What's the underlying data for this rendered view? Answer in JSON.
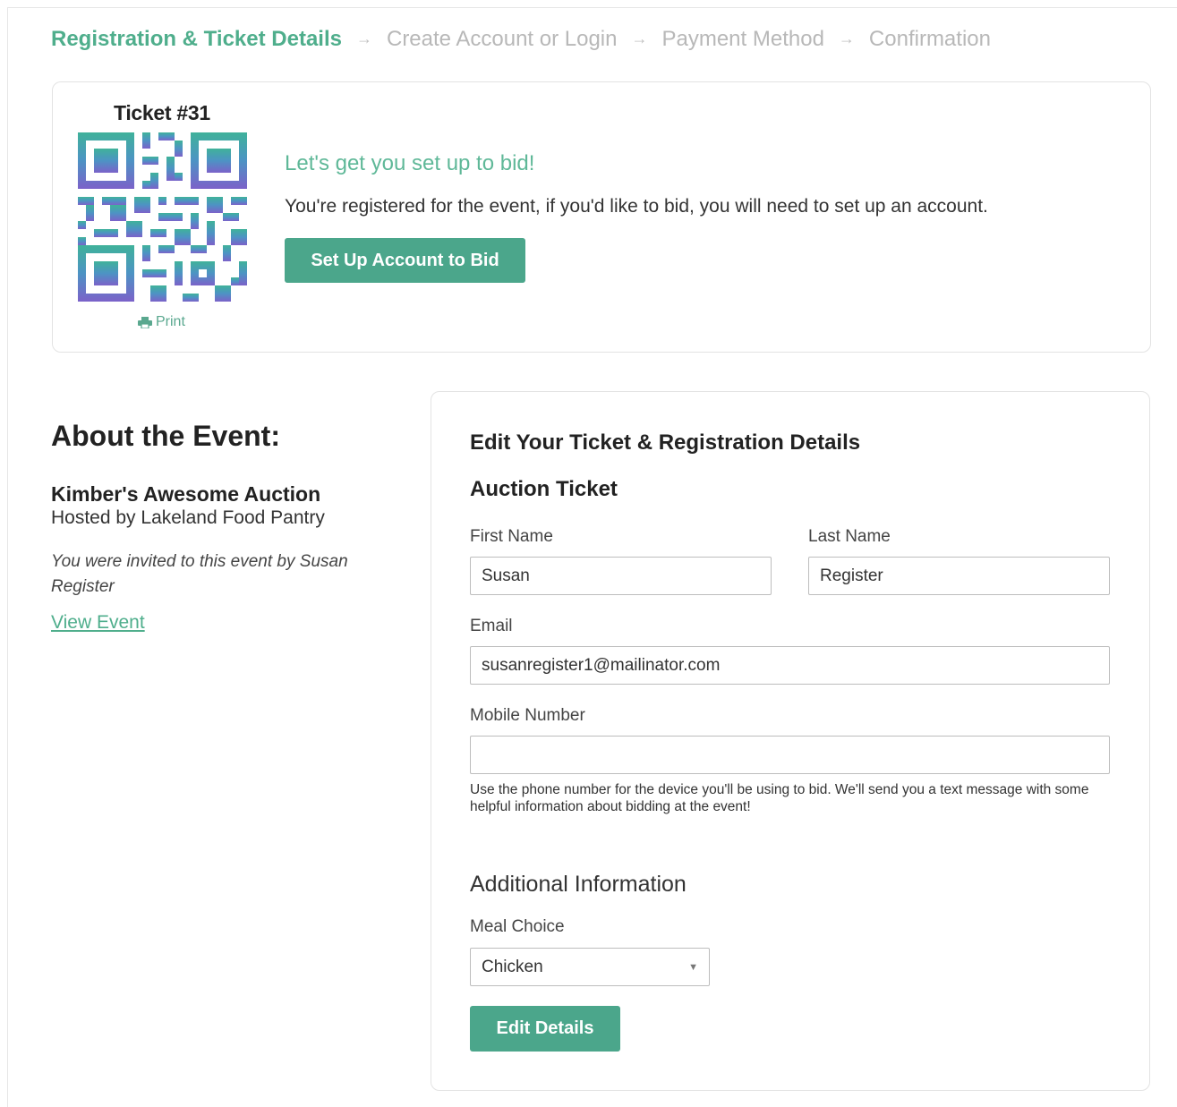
{
  "steps": [
    {
      "label": "Registration & Ticket Details",
      "active": true
    },
    {
      "label": "Create Account or Login",
      "active": false
    },
    {
      "label": "Payment Method",
      "active": false
    },
    {
      "label": "Confirmation",
      "active": false
    }
  ],
  "ticket": {
    "title": "Ticket #31",
    "qr_icon": "qr-code",
    "print_label": "Print",
    "heading": "Let's get you set up to bid!",
    "message": "You're registered for the event, if you'd like to bid, you will need to set up an account.",
    "button_label": "Set Up Account to Bid"
  },
  "about": {
    "title": "About the Event:",
    "event_name": "Kimber's Awesome Auction",
    "hosted_by": "Hosted by Lakeland Food Pantry",
    "invited_text": "You were invited to this event by Susan Register",
    "view_event_label": "View Event"
  },
  "form": {
    "title": "Edit Your Ticket & Registration Details",
    "ticket_type": "Auction Ticket",
    "first_name": {
      "label": "First Name",
      "value": "Susan"
    },
    "last_name": {
      "label": "Last Name",
      "value": "Register"
    },
    "email": {
      "label": "Email",
      "value": "susanregister1@mailinator.com"
    },
    "mobile": {
      "label": "Mobile Number",
      "value": "",
      "help": "Use the phone number for the device you'll be using to bid. We'll send you a text message with some helpful information about bidding at the event!"
    },
    "additional_title": "Additional Information",
    "meal": {
      "label": "Meal Choice",
      "value": "Chicken"
    },
    "submit_label": "Edit Details"
  },
  "colors": {
    "accent": "#4ba68b",
    "link": "#4fae8c",
    "muted_step": "#b8b8b8"
  }
}
